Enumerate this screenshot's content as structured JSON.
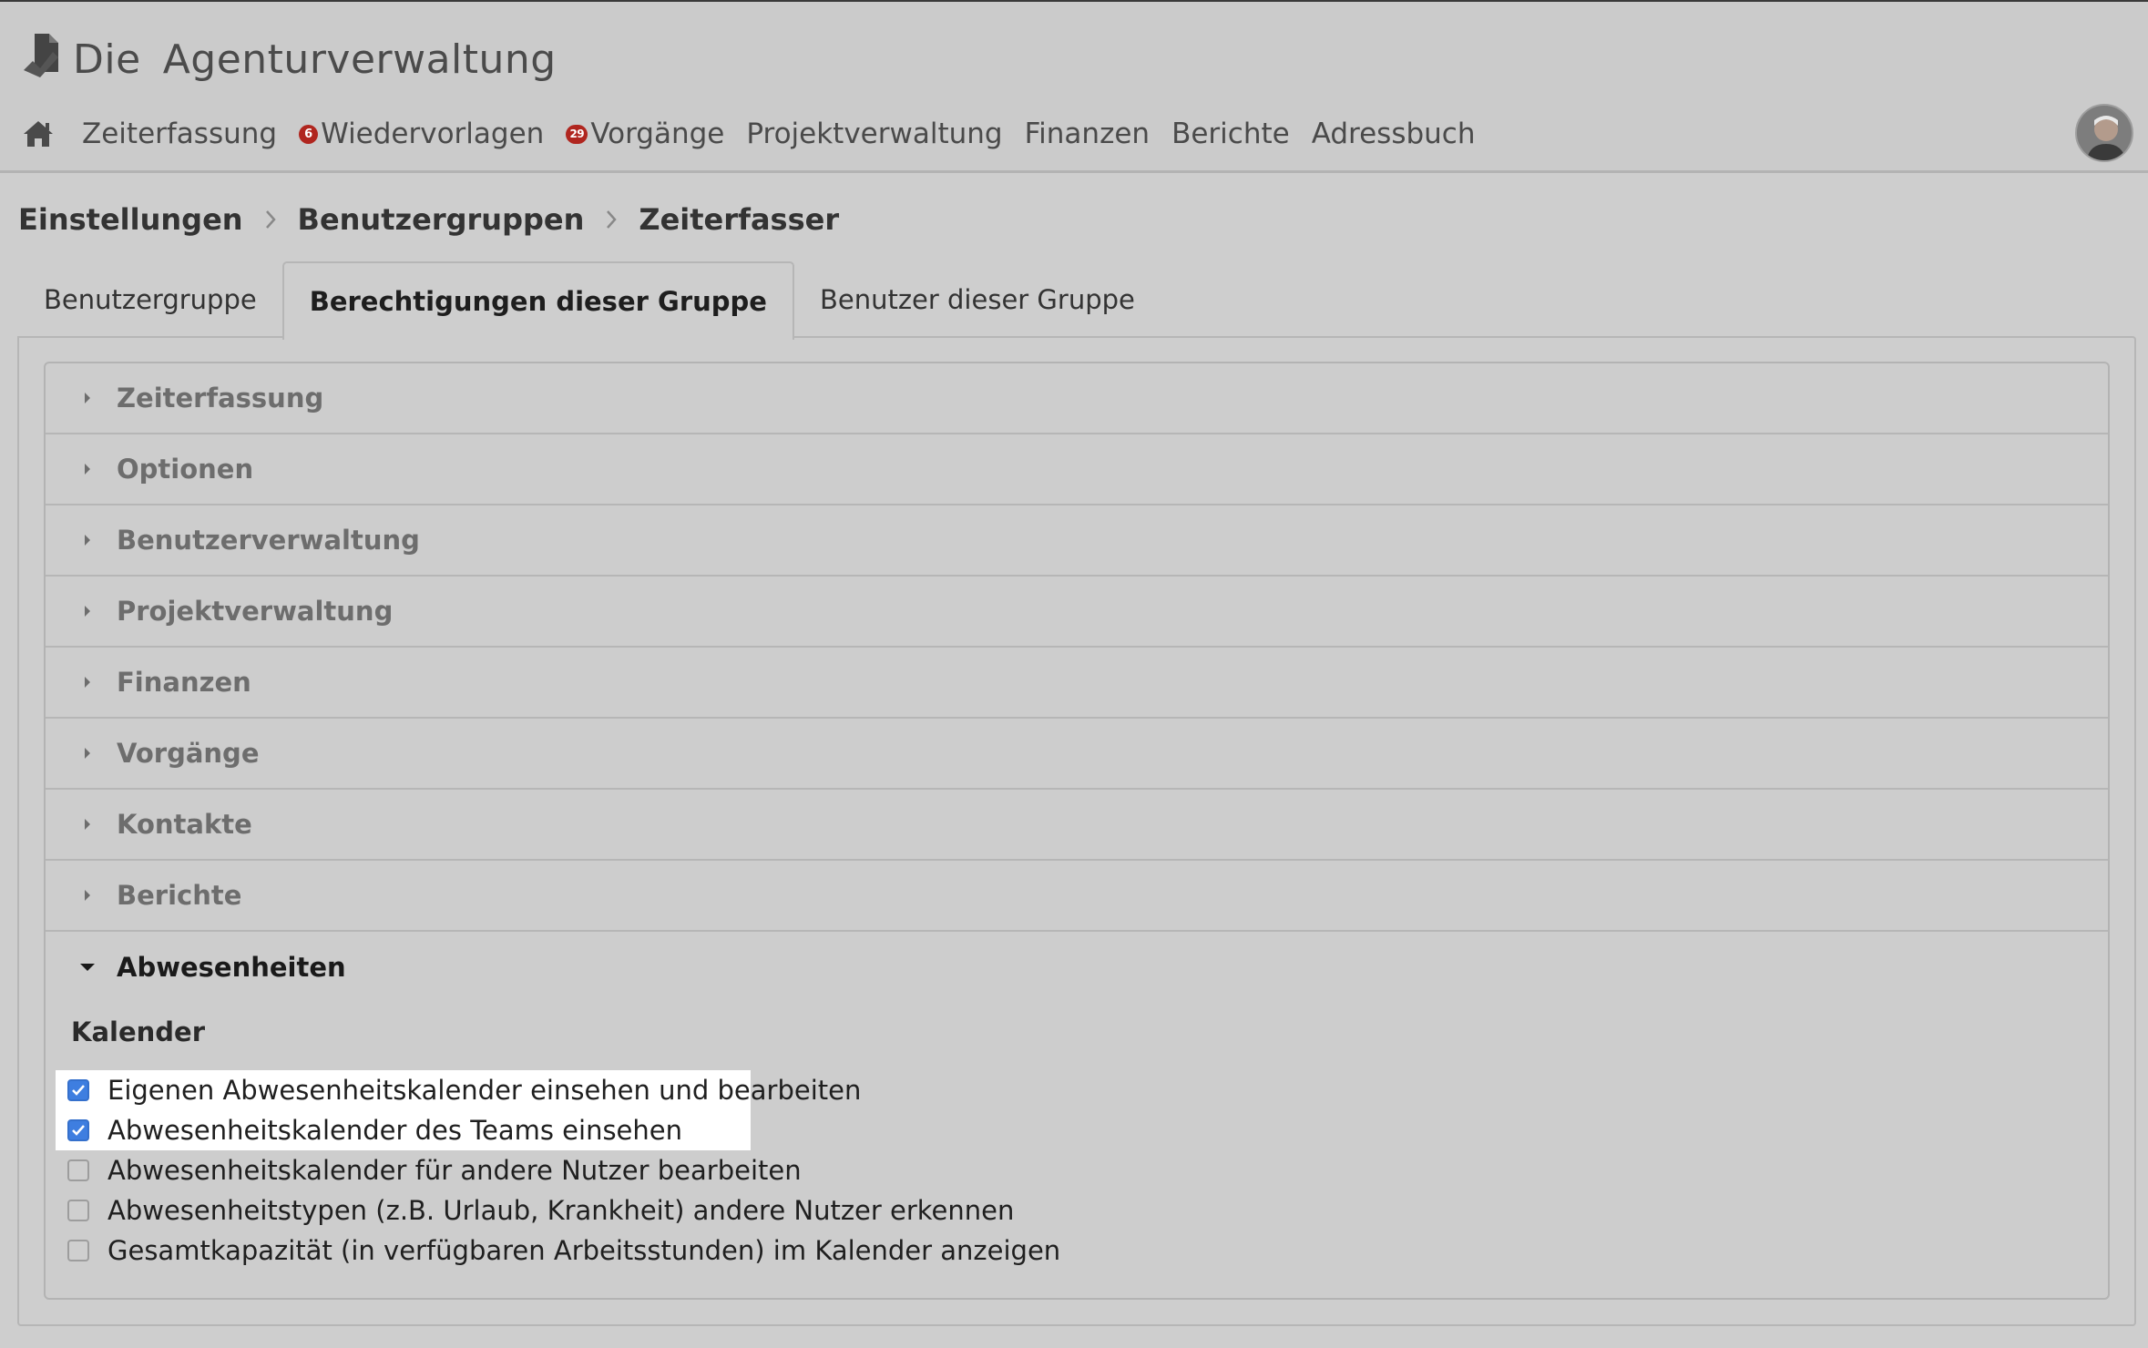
{
  "app": {
    "logo_word1": "Die",
    "logo_word2": "Agenturverwaltung"
  },
  "nav": {
    "items": [
      {
        "label": "Zeiterfassung"
      },
      {
        "label": "Wiedervorlagen",
        "badge": "6"
      },
      {
        "label": "Vorgänge",
        "badge": "29"
      },
      {
        "label": "Projektverwaltung"
      },
      {
        "label": "Finanzen"
      },
      {
        "label": "Berichte"
      },
      {
        "label": "Adressbuch"
      }
    ]
  },
  "breadcrumb": [
    "Einstellungen",
    "Benutzergruppen",
    "Zeiterfasser"
  ],
  "tabs": [
    {
      "label": "Benutzergruppe",
      "active": false
    },
    {
      "label": "Berechtigungen dieser Gruppe",
      "active": true
    },
    {
      "label": "Benutzer dieser Gruppe",
      "active": false
    }
  ],
  "accordion": {
    "sections": [
      {
        "label": "Zeiterfassung"
      },
      {
        "label": "Optionen"
      },
      {
        "label": "Benutzerverwaltung"
      },
      {
        "label": "Projektverwaltung"
      },
      {
        "label": "Finanzen"
      },
      {
        "label": "Vorgänge"
      },
      {
        "label": "Kontakte"
      },
      {
        "label": "Berichte"
      }
    ],
    "open_section": {
      "label": "Abwesenheiten",
      "group_title": "Kalender",
      "permissions": [
        {
          "label": "Eigenen Abwesenheitskalender einsehen und bearbeiten",
          "checked": true
        },
        {
          "label": "Abwesenheitskalender des Teams einsehen",
          "checked": true
        },
        {
          "label": "Abwesenheitskalender für andere Nutzer bearbeiten",
          "checked": false
        },
        {
          "label": "Abwesenheitstypen (z.B. Urlaub, Krankheit) andere Nutzer erkennen",
          "checked": false
        },
        {
          "label": "Gesamtkapazität (in verfügbaren Arbeitsstunden) im Kalender anzeigen",
          "checked": false
        }
      ]
    }
  },
  "colors": {
    "badge": "#b0261f",
    "checkbox_checked": "#3e7ee0",
    "highlight": "#ffffff"
  }
}
